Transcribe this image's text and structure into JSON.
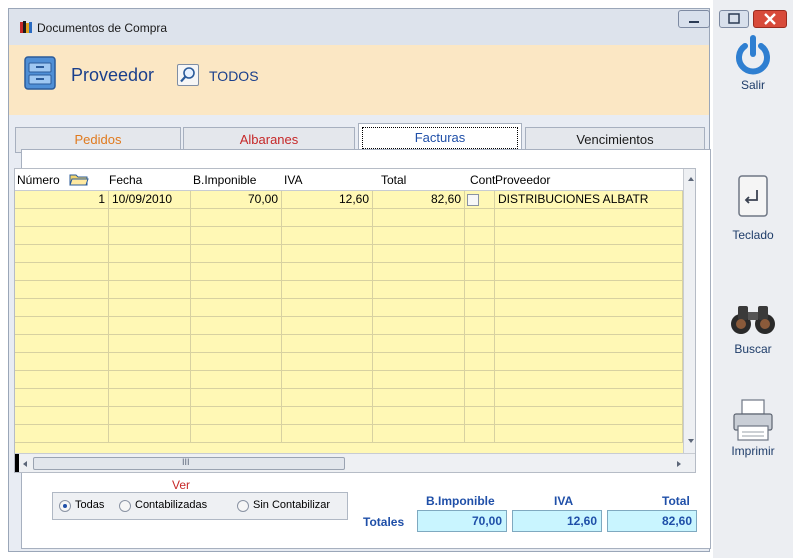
{
  "window": {
    "title": "Documentos de Compra"
  },
  "header": {
    "field_label": "Proveedor",
    "filter_value": "TODOS"
  },
  "tabs": [
    {
      "label": "Pedidos",
      "color": "#e07a1e"
    },
    {
      "label": "Albaranes",
      "color": "#c62828"
    },
    {
      "label": "Facturas",
      "color": "#1f4fa8",
      "active": true
    },
    {
      "label": "Vencimientos",
      "color": "#1b1b1b"
    }
  ],
  "grid": {
    "columns": [
      "Número",
      "Fecha",
      "B.Imponible",
      "IVA",
      "Total",
      "Cont",
      "Proveedor"
    ],
    "rows": [
      {
        "numero": "1",
        "fecha": "10/09/2010",
        "base": "70,00",
        "iva": "12,60",
        "total": "82,60",
        "cont": false,
        "proveedor": "DISTRIBUCIONES ALBATR"
      }
    ],
    "empty_rows": 13,
    "scroll_mark": "III"
  },
  "sidebar": [
    {
      "label": "Salir",
      "icon": "power-icon"
    },
    {
      "label": "Teclado",
      "icon": "keyboard-enter-icon"
    },
    {
      "label": "Buscar",
      "icon": "binoculars-icon"
    },
    {
      "label": "Imprimir",
      "icon": "printer-icon"
    }
  ],
  "filter": {
    "title": "Ver",
    "options": [
      "Todas",
      "Contabilizadas",
      "Sin Contabilizar"
    ],
    "selected": 0
  },
  "totals": {
    "label": "Totales",
    "headers": [
      "B.Imponible",
      "IVA",
      "Total"
    ],
    "values": [
      "70,00",
      "12,60",
      "82,60"
    ]
  }
}
